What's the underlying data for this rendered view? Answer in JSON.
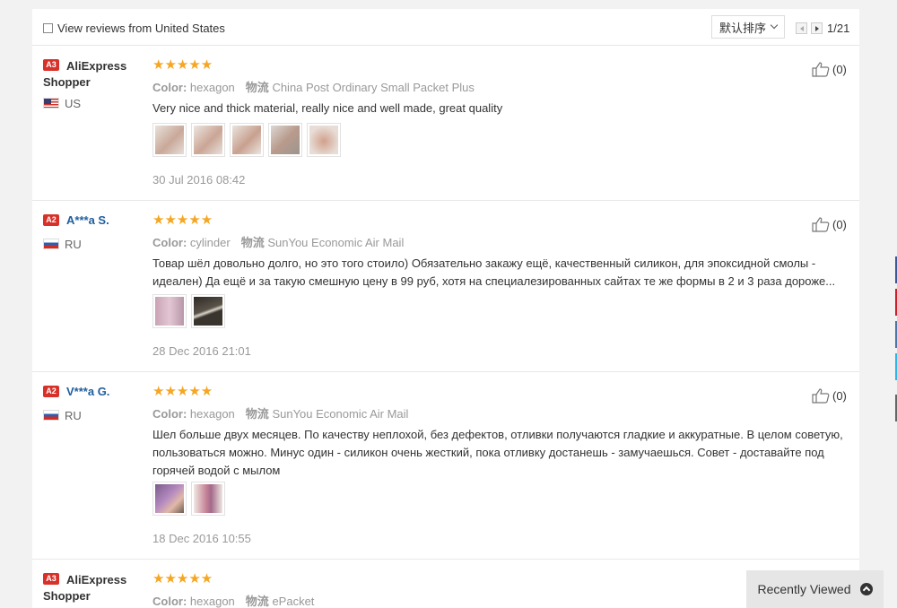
{
  "filter": {
    "label": "View reviews from United States"
  },
  "sort": {
    "label": "默认排序"
  },
  "pagination": {
    "page_label": "1/21"
  },
  "meta_labels": {
    "color": "Color:",
    "shipping": "物流"
  },
  "reviews": [
    {
      "badge": "A3",
      "user": "AliExpress Shopper",
      "country": "US",
      "stars": "★★★★★",
      "color_value": "hexagon",
      "shipping_value": "China Post Ordinary Small Packet Plus",
      "text": "Very nice and thick material, really nice and well made, great quality",
      "date": "30 Jul 2016 08:42",
      "helpful": "(0)"
    },
    {
      "badge": "A2",
      "user": "A***a S.",
      "country": "RU",
      "stars": "★★★★★",
      "color_value": "cylinder",
      "shipping_value": "SunYou Economic Air Mail",
      "text": "Товар шёл довольно долго, но это того стоило) Обязательно закажу ещё, качественный силикон, для эпоксидной смолы - идеален) Да ещё и за такую смешную цену в 99 руб, хотя на специалезированных сайтах те же формы в 2 и 3 раза дороже...",
      "date": "28 Dec 2016 21:01",
      "helpful": "(0)"
    },
    {
      "badge": "A2",
      "user": "V***a G.",
      "country": "RU",
      "stars": "★★★★★",
      "color_value": "hexagon",
      "shipping_value": "SunYou Economic Air Mail",
      "text": "Шел больше двух месяцев. По качеству неплохой, без дефектов, отливки получаются гладкие и аккуратные. В целом советую, пользоваться можно. Минус один - силикон очень жесткий, пока отливку достанешь - замучаешься. Совет - доставайте под горячей водой с мылом",
      "date": "18 Dec 2016 10:55",
      "helpful": "(0)"
    },
    {
      "badge": "A3",
      "user": "AliExpress Shopper",
      "stars": "★★★★★",
      "color_value": "hexagon",
      "shipping_value": "ePacket"
    }
  ],
  "recently_viewed": {
    "label": "Recently Viewed",
    "icon": "chevron-up-circle-icon"
  },
  "colors": {
    "star": "#f5a623",
    "badge": "#d8312a",
    "masked_name": "#1f5e9e"
  }
}
